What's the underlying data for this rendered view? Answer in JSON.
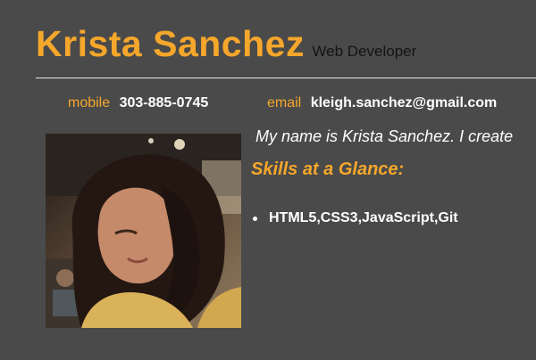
{
  "header": {
    "name": "Krista Sanchez",
    "role": "Web Developer"
  },
  "contact": {
    "mobile_label": "mobile",
    "mobile_value": "303-885-0745",
    "email_label": "email",
    "email_value": "kleigh.sanchez@gmail.com"
  },
  "photo": {
    "icon": "profile-photo"
  },
  "about": {
    "intro": "My name is Krista Sanchez. I create"
  },
  "skills": {
    "title": "Skills at a Glance:",
    "items": [
      "HTML5,CSS3,JavaScript,Git"
    ]
  },
  "colors": {
    "background": "#4a4a4a",
    "accent": "#f5a72b",
    "text": "#ffffff"
  }
}
